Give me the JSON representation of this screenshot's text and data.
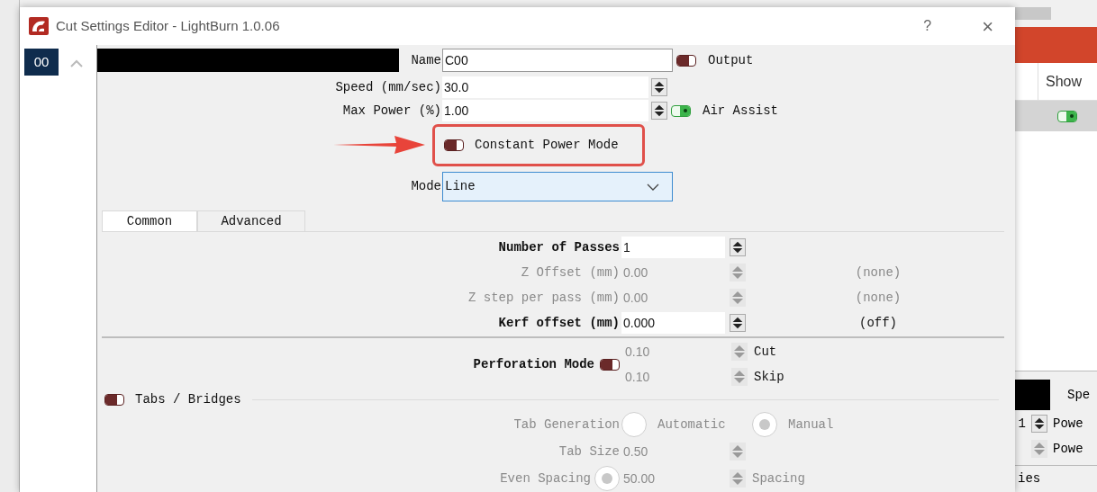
{
  "window": {
    "title": "Cut Settings Editor - LightBurn 1.0.06",
    "help": "?",
    "close": "×"
  },
  "layers": [
    {
      "label": "00",
      "selected": true
    }
  ],
  "top_rows": [
    {
      "kind": "text",
      "label": "Name",
      "value": "C00",
      "toggle": {
        "label": "Output",
        "on": false
      }
    },
    {
      "kind": "spin",
      "label": "Speed (mm/sec)",
      "value": "30.0"
    },
    {
      "kind": "spin",
      "label": "Max Power (%)",
      "value": "1.00",
      "toggle": {
        "label": "Air Assist",
        "on": true
      }
    }
  ],
  "constant_power": {
    "label": "Constant Power Mode",
    "on": false,
    "highlighted": true
  },
  "mode": {
    "label": "Mode",
    "value": "Line"
  },
  "tabs": [
    {
      "label": "Common",
      "selected": true
    },
    {
      "label": "Advanced",
      "selected": false
    }
  ],
  "common_rows": [
    {
      "label": "Number of Passes",
      "value": "1",
      "disabled": false
    },
    {
      "label": "Z Offset (mm)",
      "value": "0.00",
      "disabled": true,
      "note": "(none)"
    },
    {
      "label": "Z step per pass (mm)",
      "value": "0.00",
      "disabled": true,
      "note": "(none)"
    },
    {
      "label": "Kerf offset (mm)",
      "value": "0.000",
      "disabled": false,
      "note": "(off)"
    }
  ],
  "perforation": {
    "label": "Perforation Mode",
    "on": false,
    "rows": [
      {
        "value": "0.10",
        "label": "Cut"
      },
      {
        "value": "0.10",
        "label": "Skip"
      }
    ]
  },
  "tabs_bridges": {
    "label": "Tabs / Bridges",
    "on": false,
    "generation": {
      "label": "Tab Generation",
      "options": [
        {
          "label": "Automatic",
          "selected": false
        },
        {
          "label": "Manual",
          "selected": true
        }
      ]
    },
    "size": {
      "label": "Tab Size",
      "value": "0.50"
    },
    "even_spacing": {
      "label": "Even Spacing",
      "selected": true,
      "value": "50.00",
      "unit": "Spacing"
    }
  },
  "background_window": {
    "column": "Show",
    "show_on": true,
    "speed_label": "Spe",
    "power_rows": [
      {
        "value": "1",
        "label": "Powe"
      },
      {
        "label": "Powe"
      }
    ],
    "footer": "ies"
  }
}
